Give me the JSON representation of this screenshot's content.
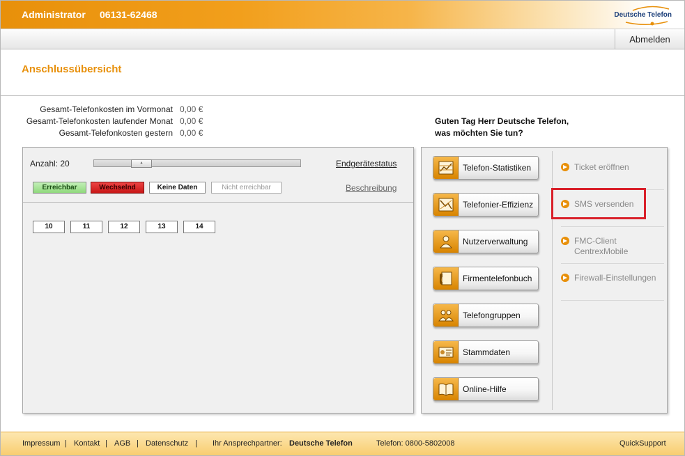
{
  "header": {
    "user": "Administrator",
    "phone": "06131-62468",
    "logo_text": "Deutsche Telefon",
    "logout_label": "Abmelden"
  },
  "page": {
    "title": "Anschlussübersicht"
  },
  "costs": [
    {
      "label": "Gesamt-Telefonkosten im Vormonat",
      "value": "0,00 €"
    },
    {
      "label": "Gesamt-Telefonkosten laufender Monat",
      "value": "0,00 €"
    },
    {
      "label": "Gesamt-Telefonkosten gestern",
      "value": "0,00 €"
    }
  ],
  "greeting": {
    "line1": "Guten Tag Herr Deutsche Telefon,",
    "line2": "was möchten Sie tun?"
  },
  "devices": {
    "count_label": "Anzahl: 20",
    "slider_fraction": 0.2,
    "status_link": "Endgerätestatus",
    "description_link": "Beschreibung",
    "legend": {
      "reachable": "Erreichbar",
      "changing": "Wechselnd",
      "no_data": "Keine Daten",
      "unreachable": "Nicht erreichbar"
    },
    "ports": [
      "10",
      "11",
      "12",
      "13",
      "14"
    ],
    "colors": {
      "reachable": "#8fd97c",
      "changing": "#c81616"
    }
  },
  "menu": [
    {
      "label": "Telefon-Statistiken",
      "icon": "statistics-icon"
    },
    {
      "label": "Telefonier-Effizienz",
      "icon": "efficiency-icon"
    },
    {
      "label": "Nutzerverwaltung",
      "icon": "user-admin-icon"
    },
    {
      "label": "Firmentelefonbuch",
      "icon": "phonebook-icon"
    },
    {
      "label": "Telefongruppen",
      "icon": "groups-icon"
    },
    {
      "label": "Stammdaten",
      "icon": "master-data-icon"
    },
    {
      "label": "Online-Hilfe",
      "icon": "help-book-icon"
    }
  ],
  "side_links": {
    "ticket": "Ticket eröffnen",
    "sms": "SMS versenden",
    "fmc_line1": "FMC-Client",
    "fmc_line2": "CentrexMobile",
    "firewall": "Firewall-Einstellungen"
  },
  "footer": {
    "impressum": "Impressum",
    "kontakt": "Kontakt",
    "agb": "AGB",
    "datenschutz": "Datenschutz",
    "partner_label": "Ihr Ansprechpartner:",
    "partner_name": "Deutsche Telefon",
    "phone": "Telefon: 0800-5802008",
    "quicksupport": "QuickSupport"
  },
  "accent_color": "#e8900a"
}
